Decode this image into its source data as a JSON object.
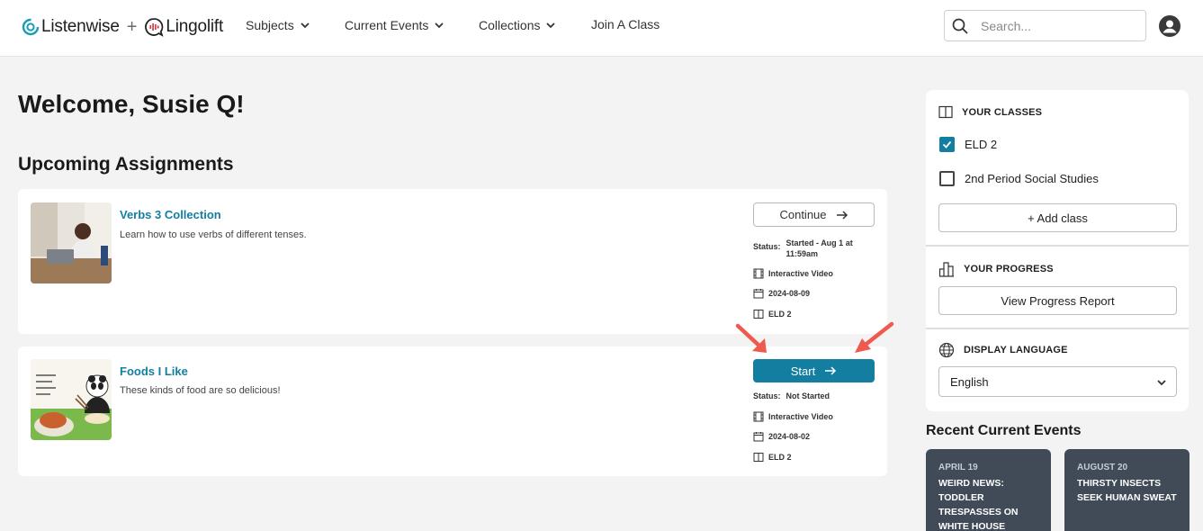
{
  "brand": {
    "name_primary": "Listenwise",
    "plus": "+",
    "name_secondary": "Lingolift"
  },
  "nav": [
    {
      "label": "Subjects"
    },
    {
      "label": "Current Events"
    },
    {
      "label": "Collections"
    },
    {
      "label": "Join A Class"
    }
  ],
  "search": {
    "placeholder": "Search...",
    "value": ""
  },
  "main": {
    "welcome": "Welcome, Susie Q!",
    "upcoming_heading": "Upcoming Assignments",
    "assignments": [
      {
        "title": "Verbs 3 Collection",
        "description": "Learn how to use verbs of different tenses.",
        "button_label": "Continue",
        "status_label": "Status:",
        "status_line1": "Started - Aug 1 at",
        "status_line2": "11:59am",
        "type": "Interactive Video",
        "date": "2024-08-09",
        "class": "ELD 2"
      },
      {
        "title": "Foods I Like",
        "description": "These kinds of food are so delicious!",
        "button_label": "Start",
        "status_label": "Status:",
        "status_line1": "Not Started",
        "type": "Interactive Video",
        "date": "2024-08-02",
        "class": "ELD 2"
      }
    ]
  },
  "sidebar": {
    "classes_heading": "YOUR CLASSES",
    "classes": [
      {
        "label": "ELD 2",
        "checked": true
      },
      {
        "label": "2nd Period Social Studies",
        "checked": false
      }
    ],
    "add_class_label": "+ Add class",
    "progress_heading": "YOUR PROGRESS",
    "progress_button": "View Progress Report",
    "language_heading": "DISPLAY LANGUAGE",
    "language_value": "English"
  },
  "recent": {
    "heading": "Recent Current Events",
    "events": [
      {
        "date": "APRIL 19",
        "headline": "WEIRD NEWS: TODDLER TRESPASSES ON WHITE HOUSE"
      },
      {
        "date": "AUGUST 20",
        "headline": "THIRSTY INSECTS SEEK HUMAN SWEAT"
      }
    ]
  },
  "colors": {
    "accent": "#137ea0",
    "event_card": "#404b57",
    "annotation_arrow": "#ef5a4f"
  }
}
